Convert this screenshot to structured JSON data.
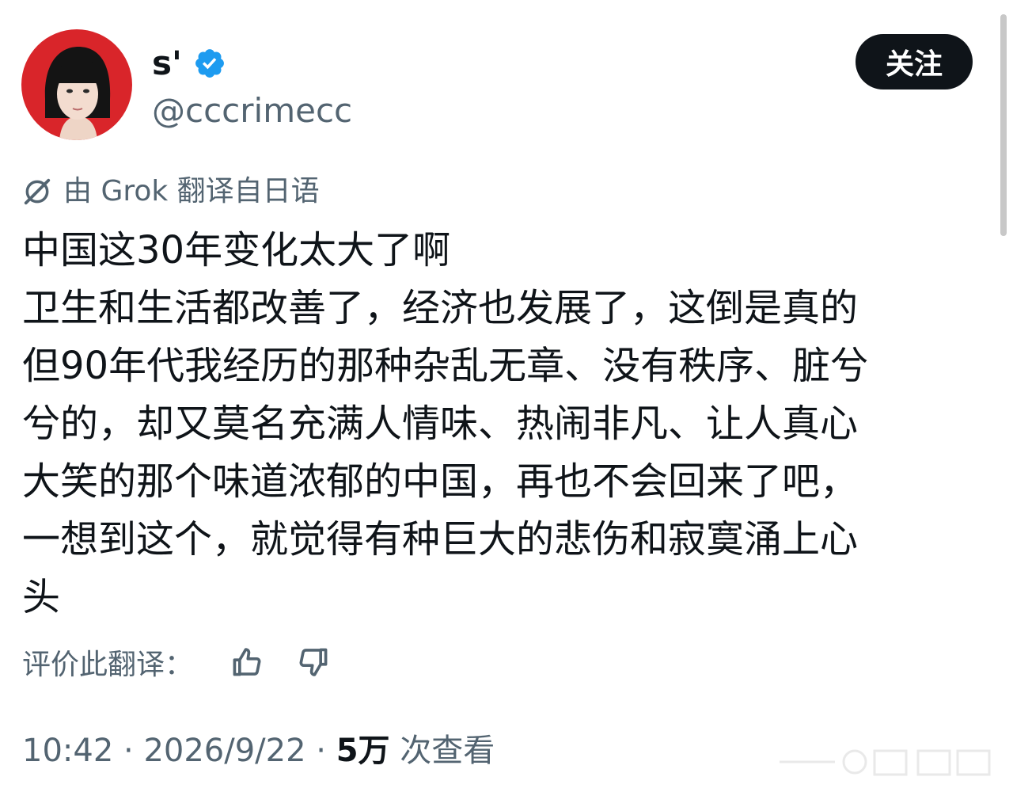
{
  "author": {
    "display_name": "s'",
    "handle": "@cccrimecc",
    "verified": true,
    "avatar_icon": "avatar-photo",
    "avatar_bg": "#d9252a"
  },
  "follow_button": {
    "label": "关注"
  },
  "translation": {
    "note": "由 Grok 翻译自日语",
    "icon": "grok-icon"
  },
  "tweet": {
    "lines": [
      "中国这30年变化太大了啊",
      "卫生和生活都改善了，经济也发展了，这倒是真的",
      "但90年代我经历的那种杂乱无章、没有秩序、脏兮",
      "兮的，却又莫名充满人情味、热闹非凡、让人真心",
      "大笑的那个味道浓郁的中国，再也不会回来了吧，",
      "一想到这个，就觉得有种巨大的悲伤和寂寞涌上心",
      "头"
    ]
  },
  "rating": {
    "label": "评价此翻译：",
    "up_icon": "thumbs-up-icon",
    "down_icon": "thumbs-down-icon"
  },
  "meta": {
    "time": "10:42",
    "separator": " · ",
    "date": "2026/9/22",
    "views_count": "5万",
    "views_label": " 次查看"
  },
  "colors": {
    "text": "#0f1419",
    "secondary": "#536471",
    "verified": "#1d9bf0",
    "button_bg": "#0f1419"
  }
}
